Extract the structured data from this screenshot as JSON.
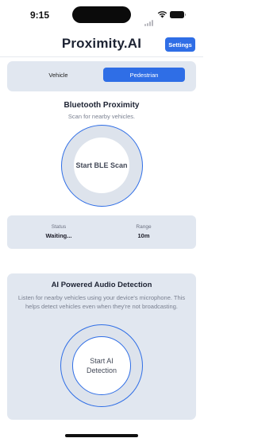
{
  "status_bar": {
    "time": "9:15"
  },
  "header": {
    "title": "Proximity.AI",
    "settings_label": "Settings"
  },
  "mode": {
    "tabs": [
      "Vehicle",
      "Pedestrian"
    ],
    "selected": "Pedestrian"
  },
  "bluetooth": {
    "title": "Bluetooth Proximity",
    "subtitle": "Scan for nearby vehicles.",
    "scan_label": "Start BLE Scan"
  },
  "stats": {
    "status_label": "Status",
    "status_value": "Waiting...",
    "range_label": "Range",
    "range_value": "10m"
  },
  "ai": {
    "title": "AI Powered Audio Detection",
    "description": "Listen for nearby vehicles using your device's microphone. This helps detect vehicles even when they're not broadcasting.",
    "button_label": "Start AI Detection"
  },
  "colors": {
    "accent": "#2f6ee6",
    "card": "#e1e7f0"
  }
}
